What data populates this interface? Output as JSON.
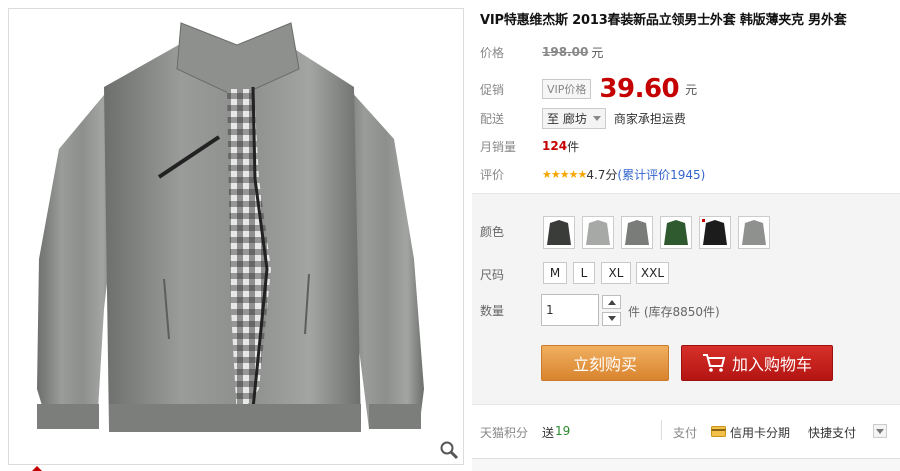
{
  "product": {
    "title": "VIP特惠维杰斯 2013春装新品立领男士外套 韩版薄夹克 男外套"
  },
  "price": {
    "label": "价格",
    "original": "198.00",
    "unit": "元"
  },
  "promo": {
    "label": "促销",
    "tag": "VIP价格",
    "price": "39.60",
    "unit": "元"
  },
  "shipping": {
    "label": "配送",
    "destination": "至 廊坊",
    "note": "商家承担运费"
  },
  "sales": {
    "label": "月销量",
    "count": "124",
    "unit": "件"
  },
  "rating": {
    "label": "评价",
    "stars": "★★★★★",
    "score": "4.7分",
    "reviews_link": "(累计评价1945)"
  },
  "options": {
    "color_label": "颜色",
    "size_label": "尺码",
    "sizes": [
      "M",
      "L",
      "XL",
      "XXL"
    ],
    "qty_label": "数量",
    "qty_value": "1",
    "stock": "件 (库存8850件)"
  },
  "actions": {
    "buy_now": "立刻购买",
    "add_to_cart": "加入购物车"
  },
  "footer": {
    "points_label": "天猫积分",
    "points_value_prefix": "送",
    "points_value": "19",
    "pay_label": "支付",
    "credit_installment": "信用卡分期",
    "quick_pay": "快捷支付"
  },
  "colors": {
    "accent_red": "#c40000",
    "buy_orange": "#e0923e",
    "cart_red": "#c01e1a",
    "jacket_gray": "#8a8c8a"
  },
  "icons": {
    "zoom": "magnifier-icon",
    "cart": "cart-icon",
    "card": "credit-card-icon"
  }
}
